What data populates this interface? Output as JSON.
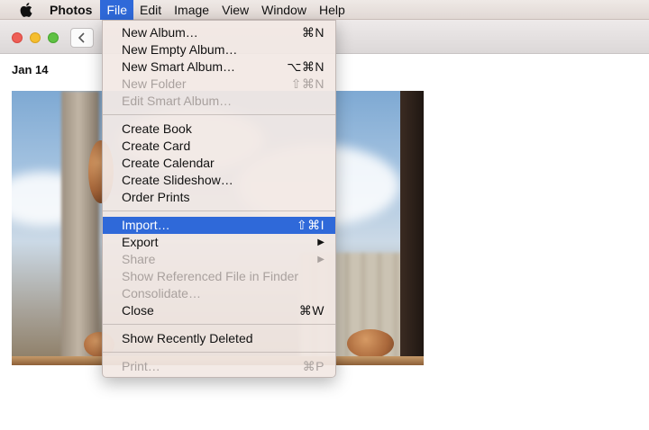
{
  "menubar": {
    "apple_icon": "apple-icon",
    "app_name": "Photos",
    "menus": [
      "File",
      "Edit",
      "Image",
      "View",
      "Window",
      "Help"
    ],
    "active_menu": "File",
    "highlight_color": "#2f69d9"
  },
  "window": {
    "back_icon": "chevron-left-icon",
    "date_label": "Jan 14"
  },
  "file_menu": {
    "groups": [
      [
        {
          "label": "New Album…",
          "shortcut": "⌘N",
          "enabled": true
        },
        {
          "label": "New Empty Album…",
          "shortcut": "",
          "enabled": true
        },
        {
          "label": "New Smart Album…",
          "shortcut": "⌥⌘N",
          "enabled": true
        },
        {
          "label": "New Folder",
          "shortcut": "⇧⌘N",
          "enabled": false
        },
        {
          "label": "Edit Smart Album…",
          "shortcut": "",
          "enabled": false
        }
      ],
      [
        {
          "label": "Create Book",
          "shortcut": "",
          "enabled": true
        },
        {
          "label": "Create Card",
          "shortcut": "",
          "enabled": true
        },
        {
          "label": "Create Calendar",
          "shortcut": "",
          "enabled": true
        },
        {
          "label": "Create Slideshow…",
          "shortcut": "",
          "enabled": true
        },
        {
          "label": "Order Prints",
          "shortcut": "",
          "enabled": true
        }
      ],
      [
        {
          "label": "Import…",
          "shortcut": "⇧⌘I",
          "enabled": true,
          "highlighted": true
        },
        {
          "label": "Export",
          "shortcut": "",
          "enabled": true,
          "submenu": true
        },
        {
          "label": "Share",
          "shortcut": "",
          "enabled": false,
          "submenu": true
        },
        {
          "label": "Show Referenced File in Finder",
          "shortcut": "",
          "enabled": false
        },
        {
          "label": "Consolidate…",
          "shortcut": "",
          "enabled": false
        },
        {
          "label": "Close",
          "shortcut": "⌘W",
          "enabled": true
        }
      ],
      [
        {
          "label": "Show Recently Deleted",
          "shortcut": "",
          "enabled": true
        }
      ],
      [
        {
          "label": "Print…",
          "shortcut": "⌘P",
          "enabled": false
        }
      ]
    ]
  }
}
